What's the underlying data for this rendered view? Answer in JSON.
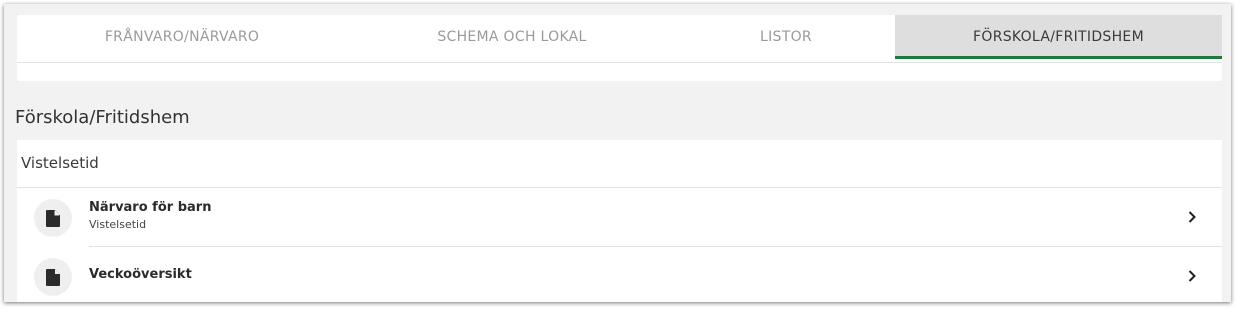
{
  "tabs": [
    {
      "label": "FRÅNVARO/NÄRVARO",
      "active": false
    },
    {
      "label": "SCHEMA OCH LOKAL",
      "active": false
    },
    {
      "label": "LISTOR",
      "active": false
    },
    {
      "label": "FÖRSKOLA/FRITIDSHEM",
      "active": true
    }
  ],
  "colors": {
    "active_tab_underline": "#1e7a3c",
    "active_tab_bg": "#dedede",
    "page_bg": "#f2f2f2"
  },
  "section": {
    "title": "Förskola/Fritidshem",
    "list_header": "Vistelsetid",
    "items": [
      {
        "title": "Närvaro för barn",
        "subtitle": "Vistelsetid",
        "icon": "document-icon"
      },
      {
        "title": "Veckoöversikt",
        "subtitle": "",
        "icon": "document-icon"
      }
    ]
  }
}
